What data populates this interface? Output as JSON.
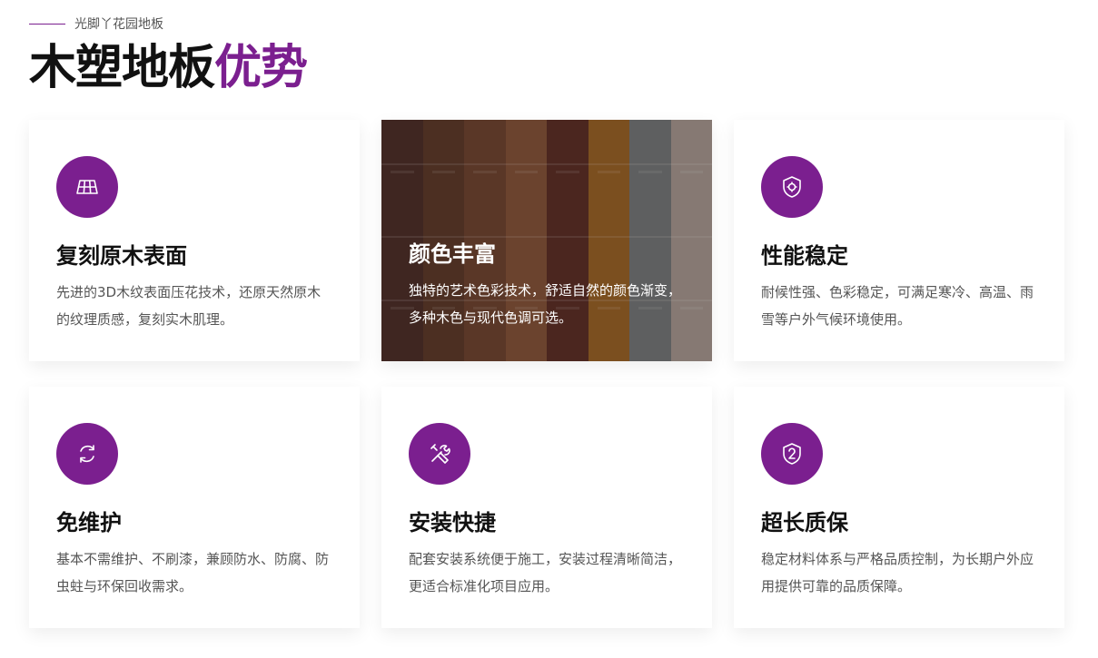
{
  "header": {
    "eyebrow": "光脚丫花园地板",
    "title_main": "木塑地板",
    "title_accent": "优势"
  },
  "cards": [
    {
      "title": "复刻原木表面",
      "desc": "先进的3D木纹表面压花技术，还原天然原木的纹理质感，复刻实木肌理。",
      "icon": "grid-panel-icon"
    },
    {
      "title": "颜色丰富",
      "desc": "独特的艺术色彩技术，舒适自然的颜色渐变，多种木色与现代色调可选。",
      "featured": true
    },
    {
      "title": "性能稳定",
      "desc": "耐候性强、色彩稳定，可满足寒冷、高温、雨雪等户外气候环境使用。",
      "icon": "shield-target-icon"
    },
    {
      "title": "免维护",
      "desc": "基本不需维护、不刷漆，兼顾防水、防腐、防虫蛀与环保回收需求。",
      "icon": "refresh-icon"
    },
    {
      "title": "安装快捷",
      "desc": "配套安装系统便于施工，安装过程清晰简洁，更适合标准化项目应用。",
      "icon": "tools-icon"
    },
    {
      "title": "超长质保",
      "desc": "稳定材料体系与严格品质控制，为长期户外应用提供可靠的品质保障。",
      "icon": "shield-number-icon"
    }
  ],
  "colors": {
    "accent": "#7b1f8f",
    "planks": [
      "#4a2e29",
      "#5b3a2a",
      "#6e4430",
      "#84553a",
      "#5a2e26",
      "#9a6426",
      "#737a7c",
      "#a89d96"
    ]
  }
}
